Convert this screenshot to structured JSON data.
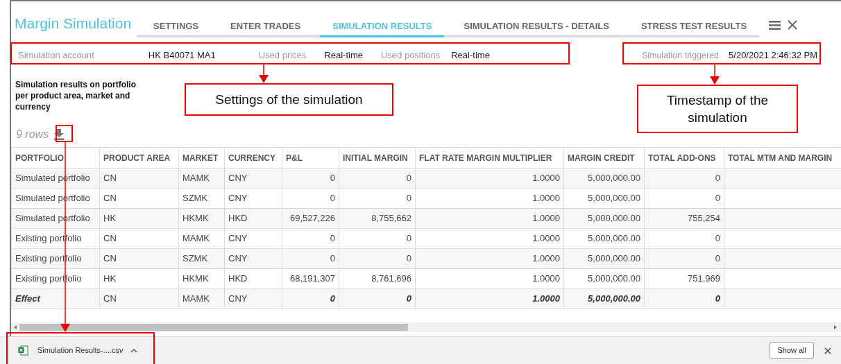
{
  "window": {
    "title": "Margin Simulation"
  },
  "tabs": [
    {
      "label": "SETTINGS",
      "selected": false
    },
    {
      "label": "ENTER TRADES",
      "selected": false
    },
    {
      "label": "SIMULATION RESULTS",
      "selected": true
    },
    {
      "label": "SIMULATION RESULTS - DETAILS",
      "selected": false
    },
    {
      "label": "STRESS TEST RESULTS",
      "selected": false
    }
  ],
  "settings": [
    {
      "label": "Simulation account",
      "value": "HK B40071 MA1"
    },
    {
      "label": "Used prices",
      "value": "Real-time"
    },
    {
      "label": "Used positions",
      "value": "Real-time"
    }
  ],
  "timestamp": {
    "label": "Simulation triggered",
    "value": "5/20/2021 2:46:32 PM"
  },
  "section_heading": "Simulation results on portfolio per product area, market and currency",
  "row_count": "9 rows",
  "table": {
    "columns": [
      {
        "label": "PORTFOLIO",
        "kind": "text"
      },
      {
        "label": "PRODUCT AREA",
        "kind": "text"
      },
      {
        "label": "MARKET",
        "kind": "text"
      },
      {
        "label": "CURRENCY",
        "kind": "text"
      },
      {
        "label": "P&L",
        "kind": "number"
      },
      {
        "label": "INITIAL MARGIN",
        "kind": "number"
      },
      {
        "label": "FLAT RATE MARGIN MULTIPLIER",
        "kind": "number"
      },
      {
        "label": "MARGIN CREDIT",
        "kind": "number"
      },
      {
        "label": "TOTAL ADD-ONS",
        "kind": "number"
      },
      {
        "label": "TOTAL MTM AND MARGIN",
        "kind": "number"
      }
    ],
    "rows": [
      {
        "kind": "data",
        "cells": [
          "Simulated portfolio",
          "CN",
          "MAMK",
          "CNY",
          "0",
          "0",
          "1.0000",
          "5,000,000.00",
          "0"
        ]
      },
      {
        "kind": "data",
        "cells": [
          "Simulated portfolio",
          "CN",
          "SZMK",
          "CNY",
          "0",
          "0",
          "1.0000",
          "5,000,000.00",
          "0"
        ]
      },
      {
        "kind": "data",
        "cells": [
          "Simulated portfolio",
          "HK",
          "HKMK",
          "HKD",
          "69,527,226",
          "8,755,662",
          "1.0000",
          "5,000,000.00",
          "755,254"
        ]
      },
      {
        "kind": "data",
        "cells": [
          "Existing portfolio",
          "CN",
          "MAMK",
          "CNY",
          "0",
          "0",
          "1.0000",
          "5,000,000.00",
          "0"
        ]
      },
      {
        "kind": "data",
        "cells": [
          "Existing portfolio",
          "CN",
          "SZMK",
          "CNY",
          "0",
          "0",
          "1.0000",
          "5,000,000.00",
          "0"
        ]
      },
      {
        "kind": "data",
        "cells": [
          "Existing portfolio",
          "HK",
          "HKMK",
          "HKD",
          "68,191,307",
          "8,761,696",
          "1.0000",
          "5,000,000.00",
          "751,969"
        ]
      },
      {
        "kind": "summary",
        "cells": [
          "Effect",
          "CN",
          "MAMK",
          "CNY",
          "0",
          "0",
          "1.0000",
          "5,000,000.00",
          "0"
        ]
      }
    ]
  },
  "download_bar": {
    "file": "Simulation Results-....csv",
    "button": "Show all"
  },
  "annotations": [
    {
      "text": "Settings of the simulation"
    },
    {
      "text": "Timestamp of the simulation"
    }
  ]
}
